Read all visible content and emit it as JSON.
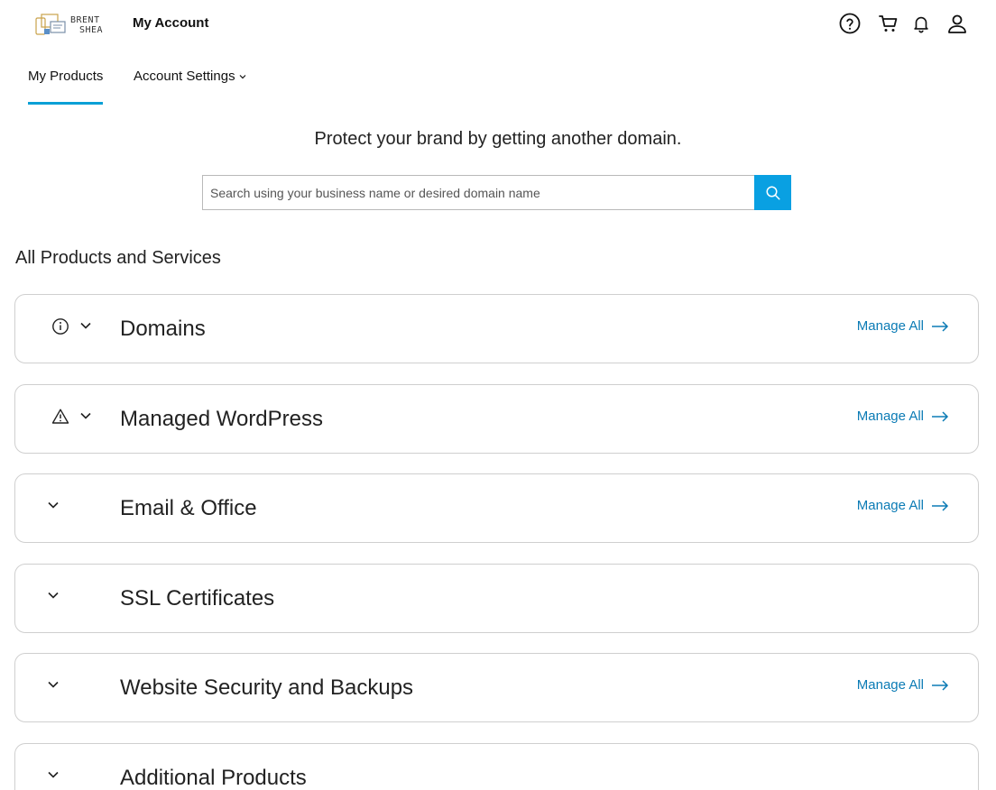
{
  "header": {
    "logo_line1": "BRENT",
    "logo_line2": "SHEA",
    "title": "My Account",
    "icons": [
      "help-icon",
      "cart-icon",
      "bell-icon",
      "user-icon"
    ]
  },
  "tabs": [
    {
      "label": "My Products",
      "active": true
    },
    {
      "label": "Account Settings",
      "active": false
    }
  ],
  "promo": {
    "headline": "Protect your brand by getting another domain.",
    "search_placeholder": "Search using your business name or desired domain name"
  },
  "section_title": "All Products and Services",
  "products": [
    {
      "name": "Domains",
      "status_icon": "info-icon",
      "manage_label": "Manage All"
    },
    {
      "name": "Managed WordPress",
      "status_icon": "warning-icon",
      "manage_label": "Manage All"
    },
    {
      "name": "Email & Office",
      "status_icon": null,
      "manage_label": "Manage All"
    },
    {
      "name": "SSL Certificates",
      "status_icon": null,
      "manage_label": null
    },
    {
      "name": "Website Security and Backups",
      "status_icon": null,
      "manage_label": "Manage All"
    },
    {
      "name": "Additional Products",
      "status_icon": null,
      "manage_label": null
    }
  ],
  "colors": {
    "accent": "#09a0e2",
    "link": "#0b7bb5",
    "border": "#cfcfcf"
  }
}
